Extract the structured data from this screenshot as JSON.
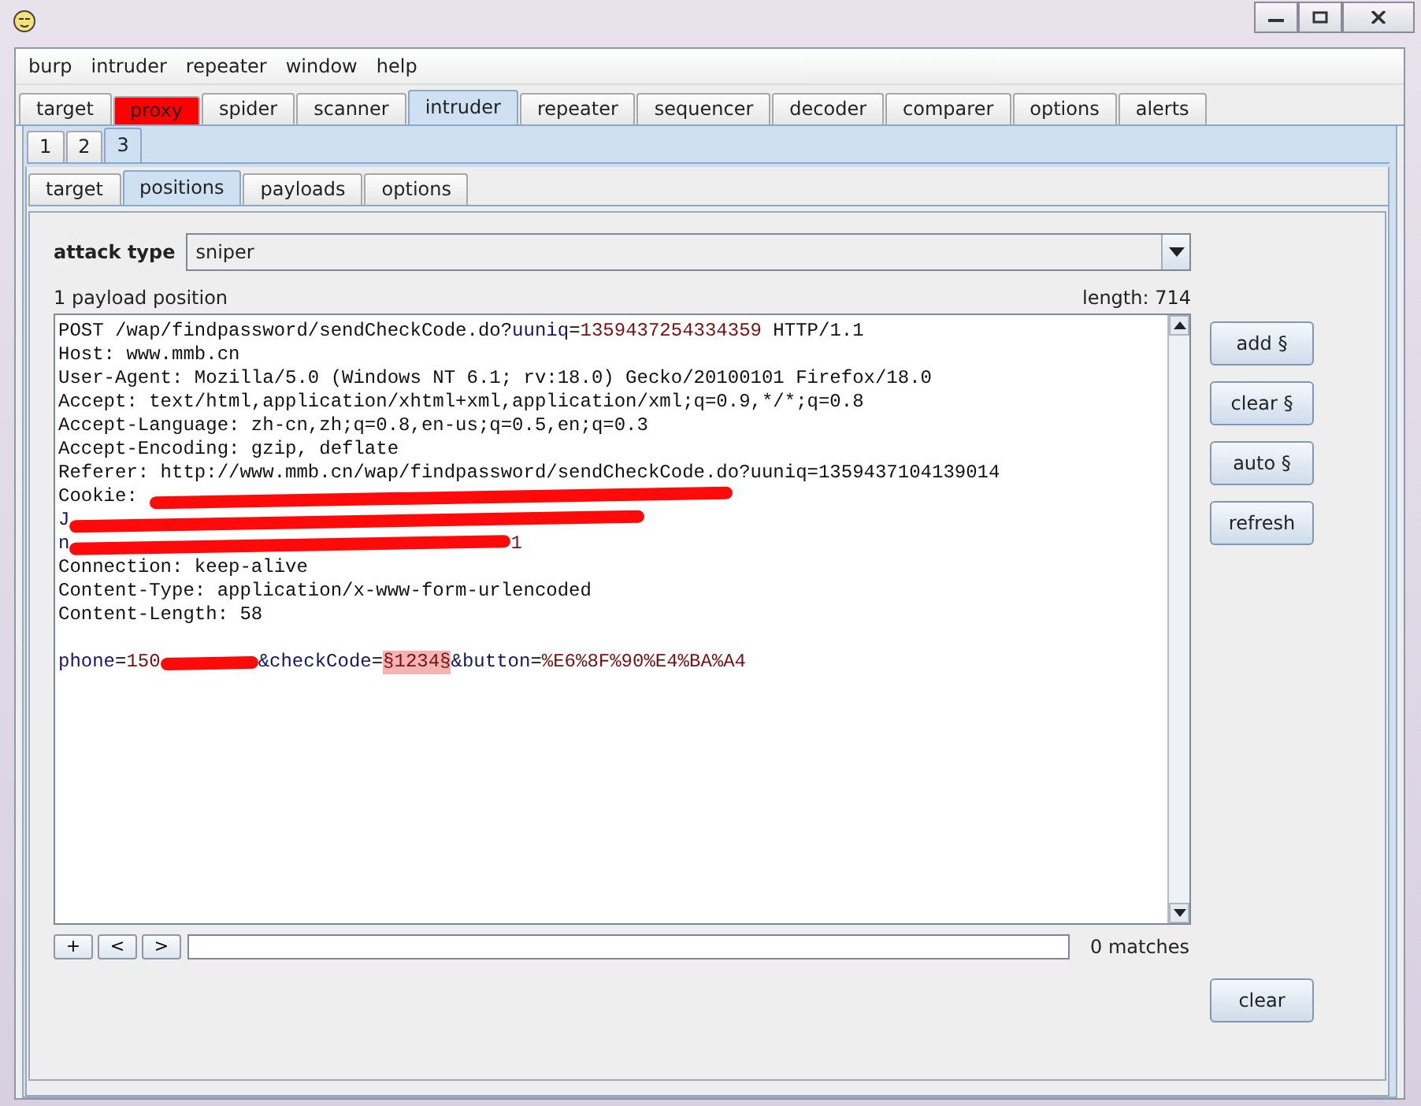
{
  "menu": [
    "burp",
    "intruder",
    "repeater",
    "window",
    "help"
  ],
  "main_tabs": [
    {
      "label": "target",
      "selected": false
    },
    {
      "label": "proxy",
      "selected": false,
      "color": "#ff0000"
    },
    {
      "label": "spider",
      "selected": false
    },
    {
      "label": "scanner",
      "selected": false
    },
    {
      "label": "intruder",
      "selected": true
    },
    {
      "label": "repeater",
      "selected": false
    },
    {
      "label": "sequencer",
      "selected": false
    },
    {
      "label": "decoder",
      "selected": false
    },
    {
      "label": "comparer",
      "selected": false
    },
    {
      "label": "options",
      "selected": false
    },
    {
      "label": "alerts",
      "selected": false
    }
  ],
  "attack_tabs": [
    {
      "label": "1",
      "selected": false
    },
    {
      "label": "2",
      "selected": false
    },
    {
      "label": "3",
      "selected": true
    }
  ],
  "sub_tabs": [
    {
      "label": "target",
      "selected": false
    },
    {
      "label": "positions",
      "selected": true
    },
    {
      "label": "payloads",
      "selected": false
    },
    {
      "label": "options",
      "selected": false
    }
  ],
  "attack_type": {
    "label": "attack type",
    "value": "sniper"
  },
  "payload_count": "1 payload position",
  "length": "length: 714",
  "request_lines": [
    {
      "kind": "text",
      "segments": [
        {
          "kind": "plain",
          "text": "POST /wap/findpassword/sendCheckCode.do?"
        },
        {
          "kind": "name",
          "text": "uuniq"
        },
        {
          "kind": "plain",
          "text": "="
        },
        {
          "kind": "value",
          "text": "1359437254334359"
        },
        {
          "kind": "plain",
          "text": " HTTP/1.1"
        }
      ]
    },
    {
      "kind": "text",
      "segments": [
        {
          "kind": "plain",
          "text": "Host: www.mmb.cn"
        }
      ]
    },
    {
      "kind": "text",
      "segments": [
        {
          "kind": "plain",
          "text": "User-Agent: Mozilla/5.0 (Windows NT 6.1; rv:18.0) Gecko/20100101 Firefox/18.0"
        }
      ]
    },
    {
      "kind": "text",
      "segments": [
        {
          "kind": "plain",
          "text": "Accept: text/html,application/xhtml+xml,application/xml;q=0.9,*/*;q=0.8"
        }
      ]
    },
    {
      "kind": "text",
      "segments": [
        {
          "kind": "plain",
          "text": "Accept-Language: zh-cn,zh;q=0.8,en-us;q=0.5,en;q=0.3"
        }
      ]
    },
    {
      "kind": "text",
      "segments": [
        {
          "kind": "plain",
          "text": "Accept-Encoding: gzip, deflate"
        }
      ]
    },
    {
      "kind": "text",
      "segments": [
        {
          "kind": "plain",
          "text": "Referer: http://www.mmb.cn/wap/findpassword/sendCheckCode.do?uuniq=1359437104139014"
        }
      ]
    },
    {
      "kind": "text",
      "segments": [
        {
          "kind": "plain",
          "text": "Cookie: "
        },
        {
          "kind": "redacted"
        }
      ]
    },
    {
      "kind": "text",
      "segments": [
        {
          "kind": "name",
          "text": "J"
        },
        {
          "kind": "redacted"
        }
      ]
    },
    {
      "kind": "text",
      "segments": [
        {
          "kind": "name",
          "text": "n"
        },
        {
          "kind": "redacted"
        },
        {
          "kind": "value",
          "text": "1"
        }
      ]
    },
    {
      "kind": "text",
      "segments": [
        {
          "kind": "plain",
          "text": "Connection: keep-alive"
        }
      ]
    },
    {
      "kind": "text",
      "segments": [
        {
          "kind": "plain",
          "text": "Content-Type: application/x-www-form-urlencoded"
        }
      ]
    },
    {
      "kind": "text",
      "segments": [
        {
          "kind": "plain",
          "text": "Content-Length: 58"
        }
      ]
    },
    {
      "kind": "blank"
    },
    {
      "kind": "text",
      "segments": [
        {
          "kind": "name",
          "text": "phone"
        },
        {
          "kind": "plain",
          "text": "="
        },
        {
          "kind": "value",
          "text": "150"
        },
        {
          "kind": "redacted"
        },
        {
          "kind": "name",
          "text": "&checkCode"
        },
        {
          "kind": "plain",
          "text": "="
        },
        {
          "kind": "payload",
          "text": "§1234§"
        },
        {
          "kind": "name",
          "text": "&button"
        },
        {
          "kind": "plain",
          "text": "="
        },
        {
          "kind": "value",
          "text": "%E6%8F%90%E4%BA%A4"
        }
      ]
    }
  ],
  "side_buttons": [
    "add §",
    "clear §",
    "auto §",
    "refresh"
  ],
  "clear_button": "clear",
  "search_buttons": [
    "+",
    "<",
    ">"
  ],
  "matches": "0 matches"
}
